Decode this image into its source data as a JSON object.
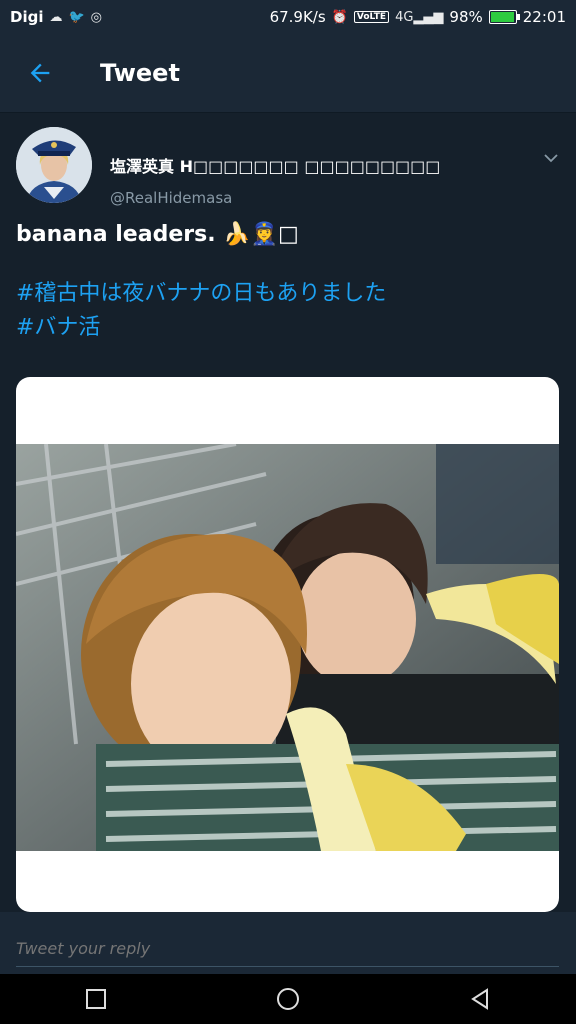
{
  "status_bar": {
    "carrier": "Digi",
    "network_speed": "67.9K/s",
    "volte": "VoLTE",
    "signal": "4G",
    "battery": "98%",
    "battery_level": 0.98,
    "time": "22:01"
  },
  "header": {
    "title": "Tweet",
    "back_icon": "arrow-left-icon"
  },
  "tweet": {
    "author": {
      "display_name": "塩澤英真 H□□□□□□□ □□□□□□□□□",
      "handle": "@RealHidemasa"
    },
    "text": "banana leaders. 🍌👮‍♀️□",
    "hashtags": [
      "#稽古中は夜バナナの日もありました",
      "#バナ活"
    ]
  },
  "reply": {
    "placeholder": "Tweet your reply"
  },
  "colors": {
    "background": "#15202b",
    "header": "#1b2836",
    "accent": "#1da1f2",
    "muted": "#8899a6"
  }
}
